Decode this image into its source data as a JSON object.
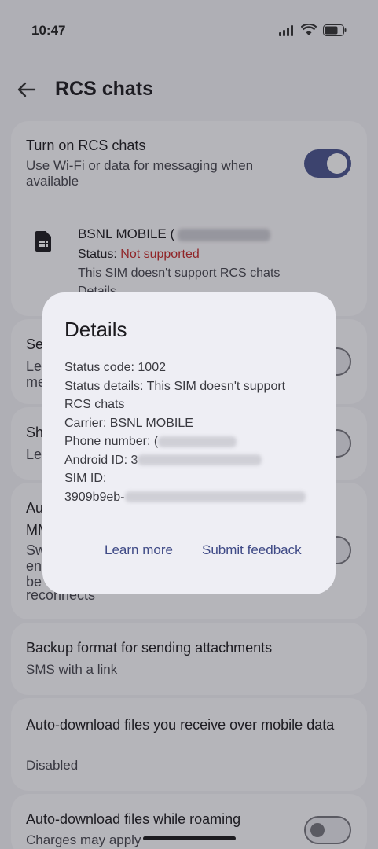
{
  "status_bar": {
    "time": "10:47"
  },
  "header": {
    "title": "RCS chats"
  },
  "rcs": {
    "title": "Turn on RCS chats",
    "subtitle": "Use Wi-Fi or data for messaging when available",
    "enabled": true
  },
  "sim": {
    "name": "BSNL MOBILE (",
    "status_label": "Status:",
    "status_value": "Not supported",
    "description": "This SIM doesn't support RCS chats",
    "details_link": "Details"
  },
  "partial_rows": {
    "row1_title": "Se",
    "row1_sub": "Le",
    "row1_sub2": "me",
    "row2_title": "Sh",
    "row2_sub": "Le",
    "row3_title": "Au",
    "row3_title2": "MM",
    "row3_sub1": "Sw",
    "row3_sub2": "en",
    "row3_sub3": "be",
    "row3_sub4": "reconnects"
  },
  "backup": {
    "title": "Backup format for sending attachments",
    "value": "SMS with a link"
  },
  "auto_download_mobile": {
    "title": "Auto-download files you receive over mobile data",
    "value": "Disabled"
  },
  "auto_download_roaming": {
    "title": "Auto-download files while roaming",
    "subtitle": "Charges may apply",
    "enabled": false
  },
  "dialog": {
    "title": "Details",
    "status_code": "Status code: 1002",
    "status_details": "Status details: This SIM doesn't support RCS chats",
    "status_details_line1": "Status details: This SIM doesn't support",
    "status_details_line2": "RCS chats",
    "carrier": "Carrier: BSNL MOBILE",
    "phone_label": "Phone number: (",
    "android_label": "Android ID: 3",
    "sim_id_label": "SIM ID:",
    "sim_id_value": "3909b9eb-",
    "learn_more": "Learn more",
    "submit_feedback": "Submit feedback"
  }
}
